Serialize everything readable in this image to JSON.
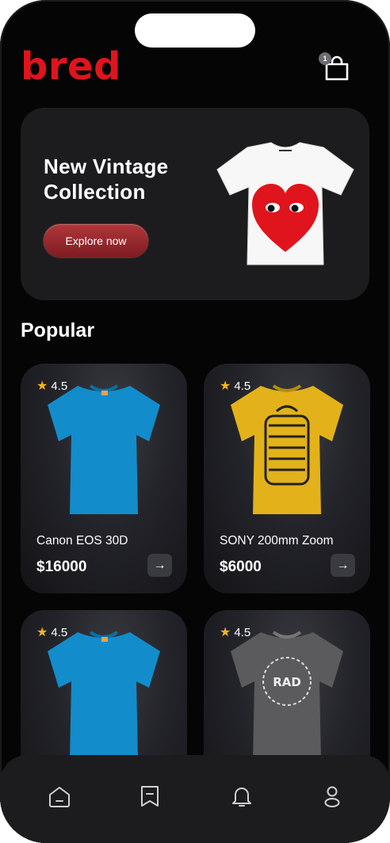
{
  "brand": {
    "logo_text": "bred",
    "color": "#e0141c"
  },
  "cart": {
    "icon": "shopping-bag-icon",
    "badge_count": "1"
  },
  "hero": {
    "title": "New Vintage Collection",
    "button_label": "Explore now",
    "image": "heart-tshirt-image"
  },
  "popular": {
    "title": "Popular",
    "products": [
      {
        "rating": "4.5",
        "name": "Canon EOS 30D",
        "price": "$16000",
        "image": "blue-tshirt"
      },
      {
        "rating": "4.5",
        "name": "SONY 200mm Zoom",
        "price": "$6000",
        "image": "yellow-graphic-tshirt"
      },
      {
        "rating": "4.5",
        "name": "",
        "price": "",
        "image": "blue-tshirt"
      },
      {
        "rating": "4.5",
        "name": "",
        "price": "",
        "image": "gray-rad-tshirt"
      }
    ]
  },
  "tabbar": {
    "items": [
      {
        "icon": "home-icon"
      },
      {
        "icon": "bookmark-icon"
      },
      {
        "icon": "bell-icon"
      },
      {
        "icon": "user-icon"
      }
    ]
  },
  "colors": {
    "background": "#050505",
    "card": "#1c1c1e",
    "accent": "#e0141c",
    "star": "#f5b324"
  }
}
